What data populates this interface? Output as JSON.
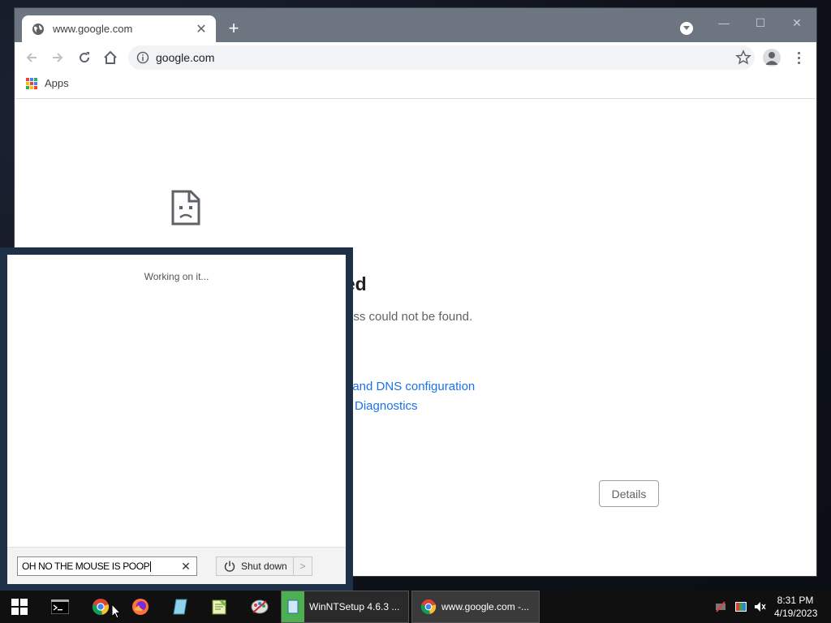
{
  "browser": {
    "tab": {
      "title": "www.google.com"
    },
    "new_tab_icon": "plus-icon",
    "window_controls": [
      "minimize",
      "maximize",
      "close"
    ],
    "address": "google.com",
    "bookmarks": {
      "apps_label": "Apps"
    }
  },
  "error_page": {
    "title_fragment": "ched",
    "message_fragment": "ress could not be found.",
    "link1_fragment": ", and DNS configuration",
    "link2_fragment": "Diagnostics",
    "details_button": "Details"
  },
  "start_panel": {
    "status": "Working on it...",
    "search_value": "OH NO THE MOUSE IS POOP",
    "shutdown_label": "Shut down"
  },
  "taskbar": {
    "buttons": [
      {
        "label": "WinNTSetup 4.6.3   ..."
      },
      {
        "label": "www.google.com -..."
      }
    ],
    "clock": {
      "time": "8:31 PM",
      "date": "4/19/2023"
    }
  },
  "colors": {
    "titlebar": "#6d7580",
    "link": "#1a73e8",
    "taskbar": "#101010",
    "panel_frame": "#1e3045"
  }
}
